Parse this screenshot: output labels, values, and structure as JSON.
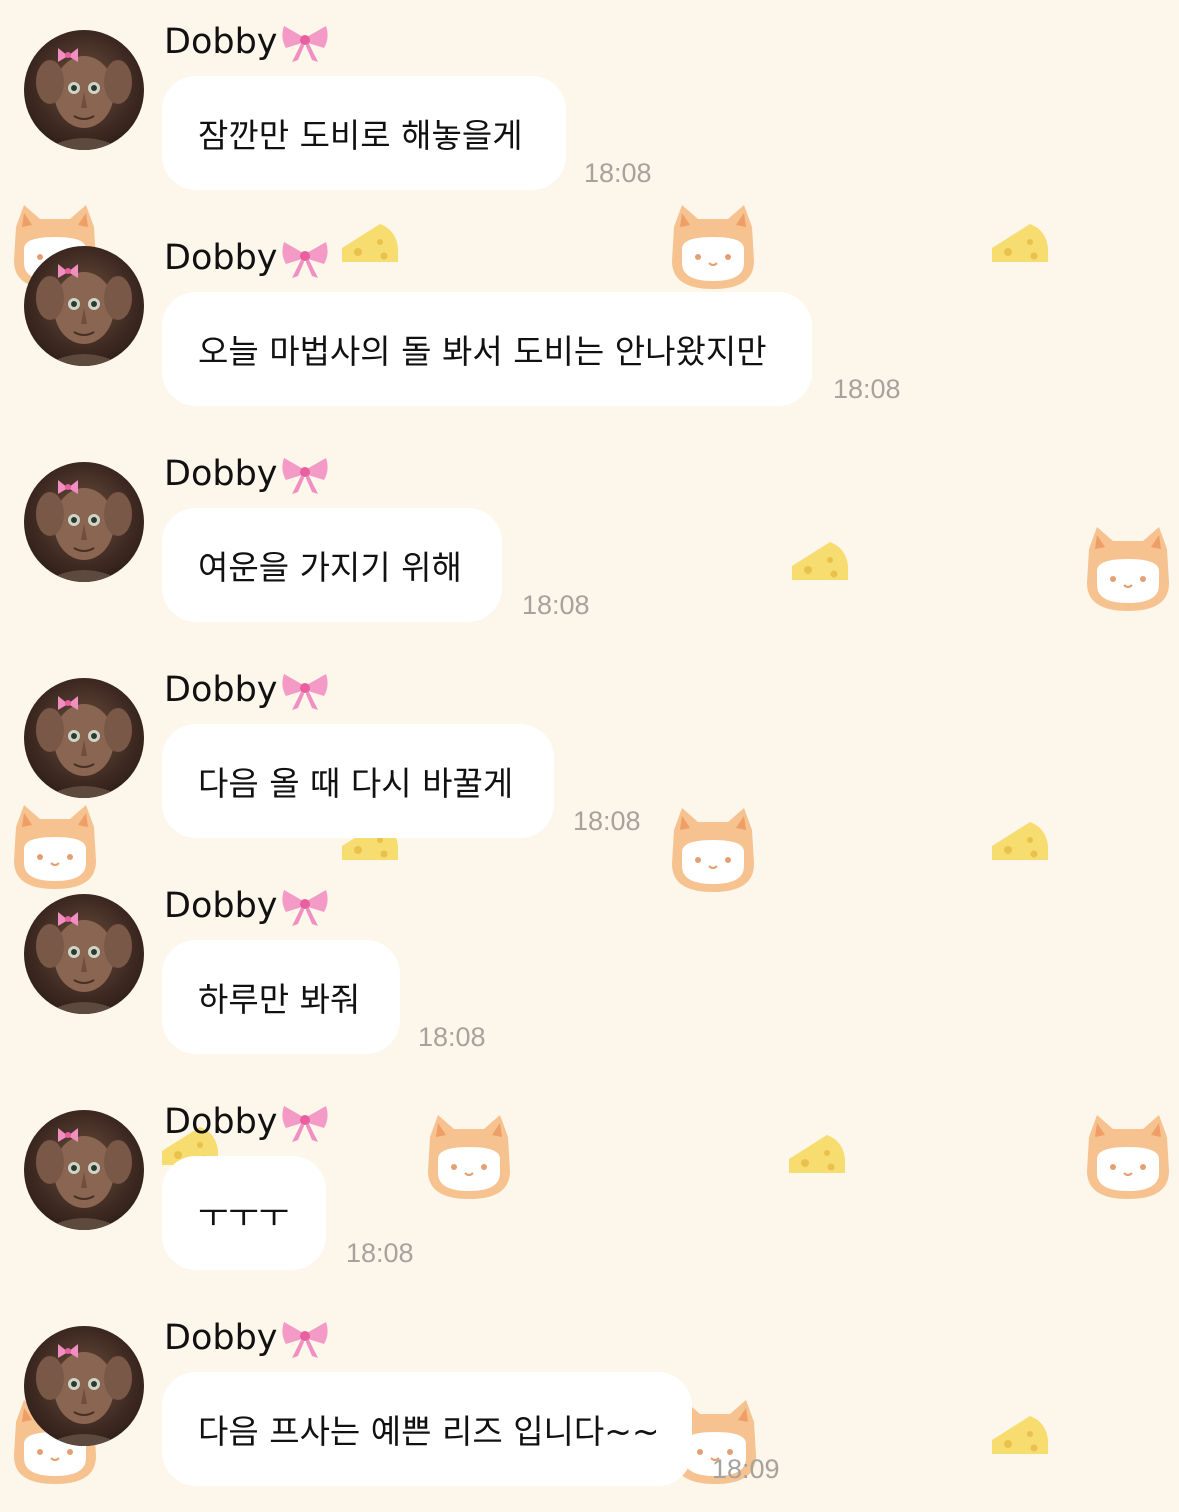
{
  "chat": {
    "messages": [
      {
        "sender": "Dobby",
        "sender_emoji": "ribbon-icon",
        "text": "잠깐만 도비로 해놓을게",
        "time": "18:08"
      },
      {
        "sender": "Dobby",
        "sender_emoji": "ribbon-icon",
        "text": "오늘 마법사의 돌 봐서 도비는 안나왔지만",
        "time": "18:08"
      },
      {
        "sender": "Dobby",
        "sender_emoji": "ribbon-icon",
        "text": "여운을 가지기 위해",
        "time": "18:08"
      },
      {
        "sender": "Dobby",
        "sender_emoji": "ribbon-icon",
        "text": "다음 올 때 다시 바꿀게",
        "time": "18:08"
      },
      {
        "sender": "Dobby",
        "sender_emoji": "ribbon-icon",
        "text": "하루만 봐줘",
        "time": "18:08"
      },
      {
        "sender": "Dobby",
        "sender_emoji": "ribbon-icon",
        "text": "ㅜㅜㅜ",
        "time": "18:08"
      },
      {
        "sender": "Dobby",
        "sender_emoji": "ribbon-icon",
        "text": "다음 프사는 예쁜 리즈 입니다~~",
        "time": "18:09"
      }
    ]
  },
  "theme": {
    "background": "#fdf6ea",
    "bubble": "#ffffff",
    "time_color": "#a6a39e",
    "cat_orange": "#f6c28f",
    "cheese_yellow": "#f7dc6f"
  }
}
